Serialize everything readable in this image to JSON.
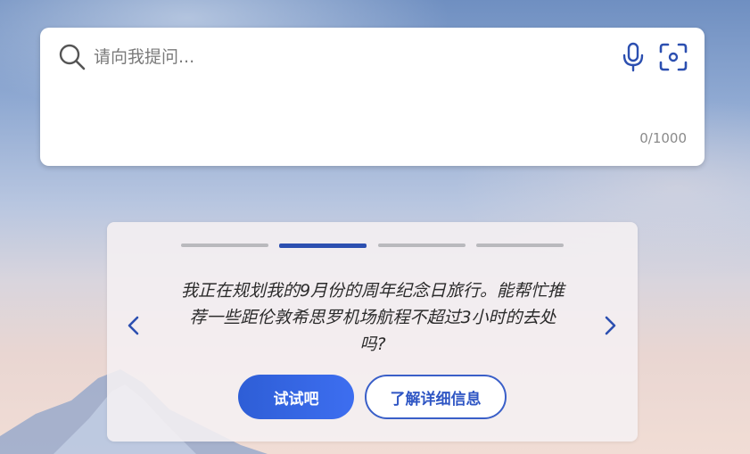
{
  "search": {
    "placeholder": "请向我提问...",
    "value": "",
    "char_count": "0/1000",
    "icons": [
      "search-icon",
      "microphone-icon",
      "camera-scan-icon"
    ]
  },
  "suggestion": {
    "carousel_total": 4,
    "carousel_active": 2,
    "prompt": "我正在规划我的9月份的周年纪念日旅行。能帮忙推荐一些距伦敦希思罗机场航程不超过3小时的去处吗?",
    "try_label": "试试吧",
    "learn_more_label": "了解详细信息",
    "icons": [
      "chevron-left-icon",
      "chevron-right-icon"
    ]
  },
  "colors": {
    "accent": "#2c4fb0",
    "primary_button": "#3366e6",
    "card_bg": "#f5f0f2"
  }
}
